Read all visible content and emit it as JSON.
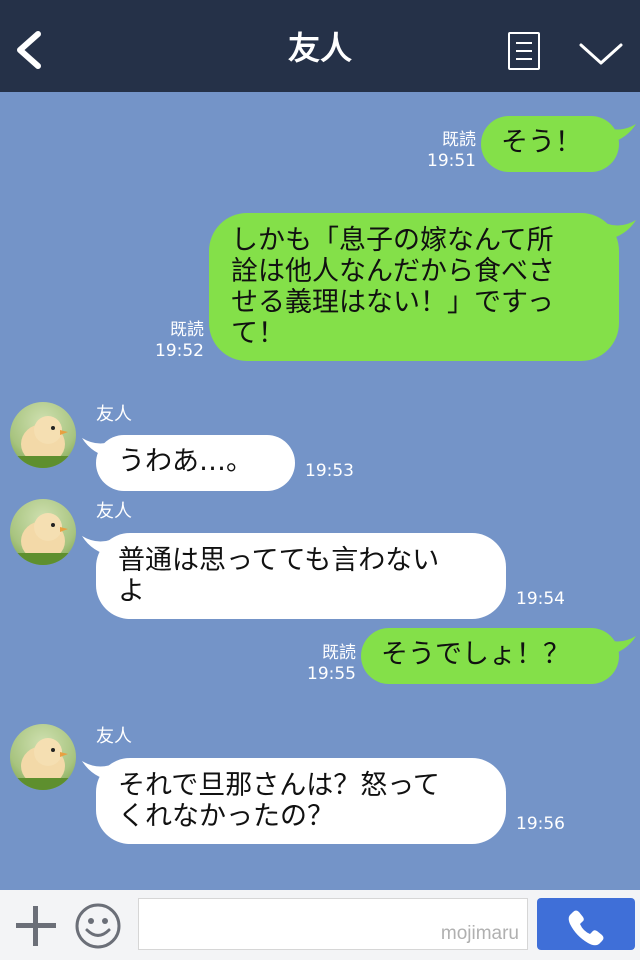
{
  "header": {
    "title": "友人",
    "back_icon": "chevron-left-icon",
    "menu_icon": "note-icon",
    "collapse_icon": "chevron-down-icon"
  },
  "messages": [
    {
      "type": "sent",
      "text": "そう！",
      "read": "既読",
      "time": "19:51"
    },
    {
      "type": "sent",
      "text": "しかも「息子の嫁なんて所\n詮は他人なんだから食べさ\nせる義理はない！」ですっ\nて！",
      "read": "既読",
      "time": "19:52"
    },
    {
      "type": "received",
      "sender": "友人",
      "text": "うわあ…。",
      "time": "19:53"
    },
    {
      "type": "received",
      "sender": "友人",
      "text": "普通は思ってても言わない\nよ",
      "time": "19:54"
    },
    {
      "type": "sent",
      "text": "そうでしょ！？",
      "read": "既読",
      "time": "19:55"
    },
    {
      "type": "received",
      "sender": "友人",
      "text": "それで旦那さんは？怒って\nくれなかったの？",
      "time": "19:56"
    }
  ],
  "input": {
    "placeholder": "",
    "watermark": "mojimaru"
  },
  "bottom": {
    "plus_icon": "plus-icon",
    "emoji_icon": "emoji-icon",
    "call_icon": "phone-icon"
  },
  "colors": {
    "background": "#7494c8",
    "header": "#253148",
    "sent_bubble": "#84e049",
    "received_bubble": "#ffffff",
    "call_button": "#3f6fd8"
  }
}
